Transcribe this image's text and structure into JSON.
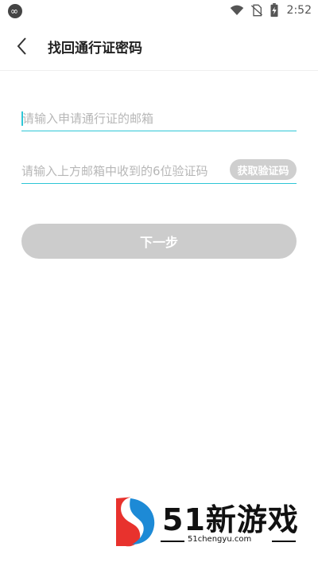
{
  "status_bar": {
    "time": "2:52",
    "icons": [
      "app-logo-icon",
      "wifi-icon",
      "no-sim-icon",
      "battery-charging-icon"
    ]
  },
  "header": {
    "title": "找回通行证密码",
    "back_icon": "chevron-left-icon"
  },
  "form": {
    "email_placeholder": "请输入申请通行证的邮箱",
    "code_placeholder": "请输入上方邮箱中收到的6位验证码",
    "get_code_label": "获取验证码",
    "next_label": "下一步"
  },
  "watermark": {
    "title": "51新游戏",
    "url": "51chengyu.com"
  },
  "colors": {
    "accent": "#2ec6d6",
    "button_disabled": "#cccccc",
    "watermark_red": "#e8322d",
    "watermark_blue": "#1d8ad6"
  }
}
